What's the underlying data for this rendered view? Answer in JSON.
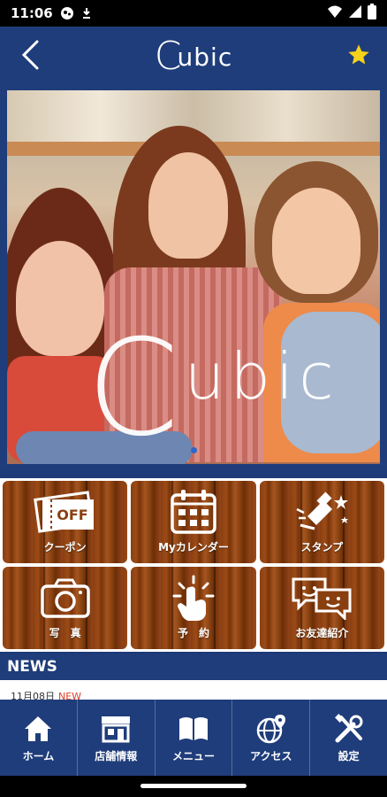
{
  "status_bar": {
    "time": "11:06",
    "icons_left": [
      "sync-icon",
      "download-icon"
    ],
    "icons_right": [
      "wifi-icon",
      "signal-icon",
      "battery-icon"
    ]
  },
  "header": {
    "logo_text": "Cubic",
    "back_icon": "back-arrow-icon",
    "favorite_icon": "star-icon",
    "favorite_color": "#f5d21b"
  },
  "hero": {
    "logo_text": "ubic",
    "logo_c": "C",
    "slide_count": 2,
    "active_slide": 1
  },
  "menu": [
    {
      "label": "クーポン",
      "icon": "coupon-off-icon",
      "icon_text": "OFF"
    },
    {
      "label": "Myカレンダー",
      "icon": "calendar-icon"
    },
    {
      "label": "スタンプ",
      "icon": "stamp-icon"
    },
    {
      "label": "写　真",
      "icon": "camera-icon"
    },
    {
      "label": "予　約",
      "icon": "tap-hand-icon"
    },
    {
      "label": "お友達紹介",
      "icon": "chat-friends-icon"
    }
  ],
  "news": {
    "title": "NEWS",
    "items": [
      {
        "date": "11月08日",
        "badge": "NEW"
      }
    ]
  },
  "bottom_nav": [
    {
      "label": "ホーム",
      "icon": "home-icon"
    },
    {
      "label": "店舗情報",
      "icon": "store-icon"
    },
    {
      "label": "メニュー",
      "icon": "book-icon"
    },
    {
      "label": "アクセス",
      "icon": "globe-pin-icon"
    },
    {
      "label": "設定",
      "icon": "tools-icon"
    }
  ],
  "colors": {
    "brand_navy": "#1f3d7a",
    "wood": "#8a3f10",
    "new_badge": "#e0402a"
  }
}
